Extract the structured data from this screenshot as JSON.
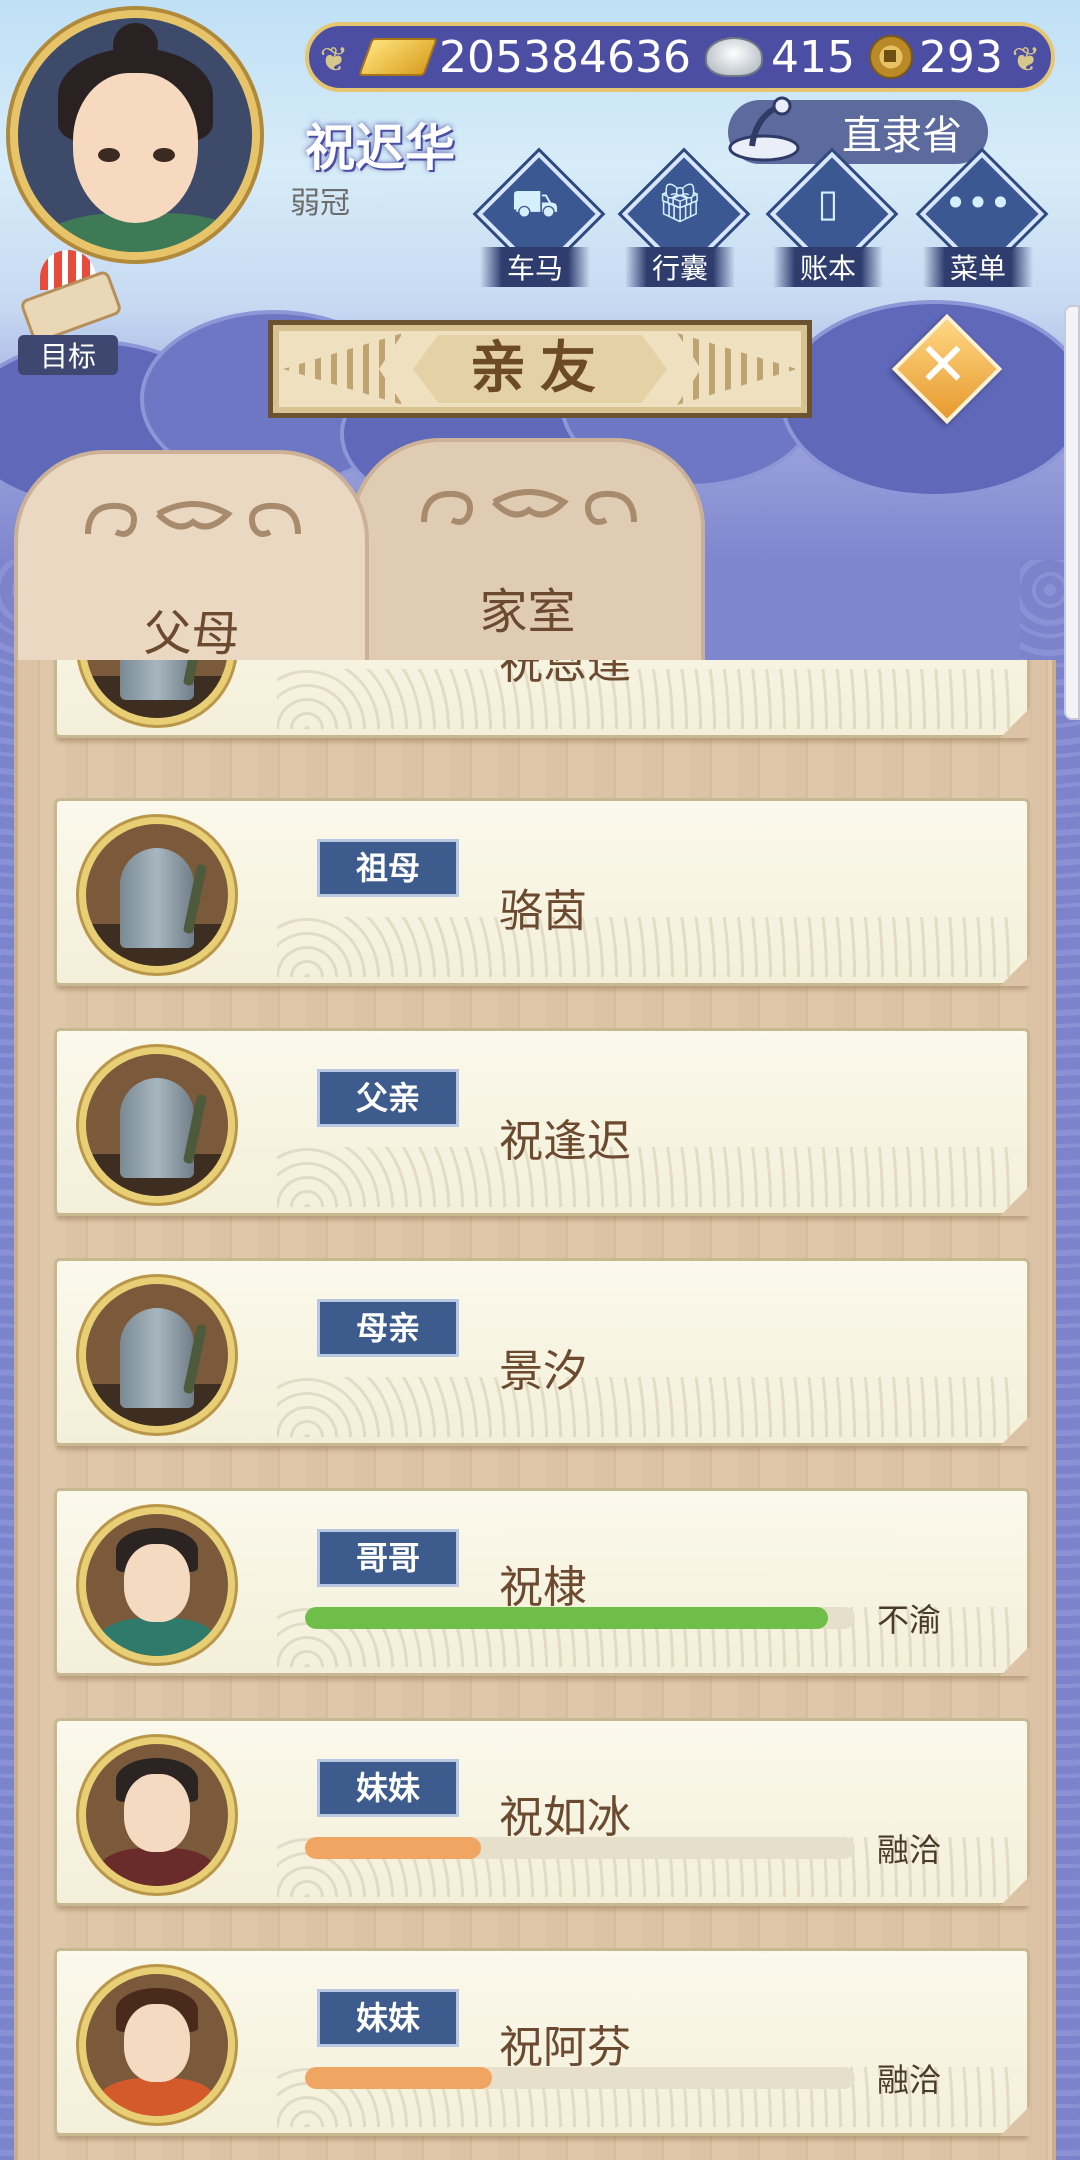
{
  "currency": {
    "gold": "205384636",
    "silver": "415",
    "copper": "293"
  },
  "player": {
    "name": "祝迟华",
    "age_title": "弱冠",
    "province": "直隶省"
  },
  "menu": [
    {
      "label": "车马",
      "icon": "carriage-icon"
    },
    {
      "label": "行囊",
      "icon": "bag-icon"
    },
    {
      "label": "账本",
      "icon": "ledger-icon"
    },
    {
      "label": "菜单",
      "icon": "menu-dots-icon"
    }
  ],
  "goal_label": "目标",
  "title": "亲友",
  "tabs": [
    "父母",
    "家室"
  ],
  "relatives": [
    {
      "badge": "",
      "name": "祝恩達",
      "portrait": "tomb",
      "bar": null,
      "status": ""
    },
    {
      "badge": "祖母",
      "name": "骆茵",
      "portrait": "tomb",
      "bar": null,
      "status": ""
    },
    {
      "badge": "父亲",
      "name": "祝逢迟",
      "portrait": "tomb",
      "bar": null,
      "status": ""
    },
    {
      "badge": "母亲",
      "name": "景汐",
      "portrait": "tomb",
      "bar": null,
      "status": ""
    },
    {
      "badge": "哥哥",
      "name": "祝棣",
      "portrait": "male",
      "bar": 0.95,
      "bar_color": "#6fbe4a",
      "status": "不渝"
    },
    {
      "badge": "妹妹",
      "name": "祝如冰",
      "portrait": "female-1",
      "bar": 0.32,
      "bar_color": "#f0a562",
      "status": "融洽"
    },
    {
      "badge": "妹妹",
      "name": "祝阿芬",
      "portrait": "female-2",
      "bar": 0.34,
      "bar_color": "#f0a562",
      "status": "融洽"
    }
  ]
}
